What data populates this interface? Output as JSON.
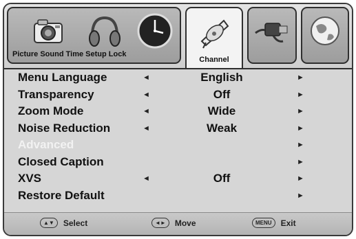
{
  "tabs": [
    {
      "name": "tab-picture-sound-time-setup-lock",
      "label": "Picture Sound Time Setup Lock",
      "active": false
    },
    {
      "name": "tab-channel",
      "label": "Channel",
      "active": true
    },
    {
      "name": "tab-connector",
      "label": "",
      "active": false
    },
    {
      "name": "tab-globe",
      "label": "",
      "active": false
    }
  ],
  "menu": [
    {
      "label": "Menu Language",
      "value": "English",
      "left_arrow": "◄",
      "right_arrow": "►",
      "disabled": false
    },
    {
      "label": "Transparency",
      "value": "Off",
      "left_arrow": "◄",
      "right_arrow": "►",
      "disabled": false
    },
    {
      "label": "Zoom Mode",
      "value": "Wide",
      "left_arrow": "◄",
      "right_arrow": "►",
      "disabled": false
    },
    {
      "label": "Noise Reduction",
      "value": "Weak",
      "left_arrow": "◄",
      "right_arrow": "►",
      "disabled": false
    },
    {
      "label": "Advanced",
      "value": "",
      "left_arrow": "",
      "right_arrow": "►",
      "disabled": true
    },
    {
      "label": "Closed Caption",
      "value": "",
      "left_arrow": "",
      "right_arrow": "►",
      "disabled": false
    },
    {
      "label": "XVS",
      "value": "Off",
      "left_arrow": "◄",
      "right_arrow": "►",
      "disabled": false
    },
    {
      "label": "Restore Default",
      "value": "",
      "left_arrow": "",
      "right_arrow": "►",
      "disabled": false
    }
  ],
  "footer": {
    "select": {
      "key": "▲▼",
      "label": "Select"
    },
    "move": {
      "key": "◄►",
      "label": "Move"
    },
    "exit": {
      "key": "MENU",
      "label": "Exit"
    }
  },
  "colors": {
    "panel": "#d6d6d6",
    "disabled_text": "#f2f2f2",
    "border": "#2f2f2f"
  }
}
